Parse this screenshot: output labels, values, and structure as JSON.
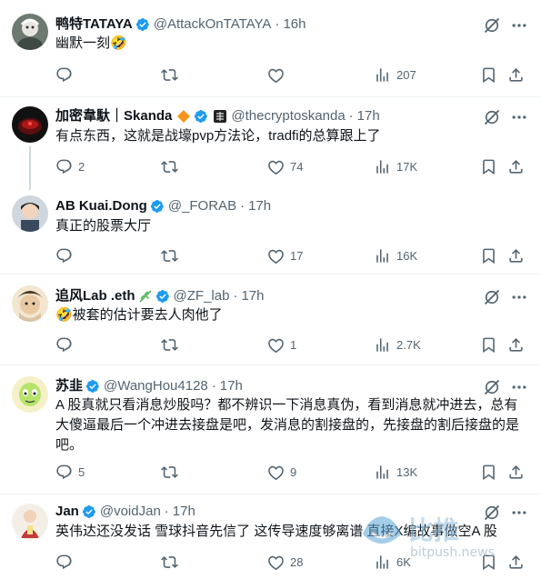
{
  "tweets": [
    {
      "name": "鸭特TATAYA",
      "handle": "@AttackOnTATAYA",
      "time": "16h",
      "text": "幽默一刻🤣",
      "replies": "",
      "retweets": "",
      "likes": "",
      "views": "207"
    },
    {
      "name": "加密韋馱｜Skanda",
      "handle": "@thecryptoskanda",
      "time": "17h",
      "text": "有点东西，这就是战壕pvp方法论，tradfi的总算跟上了",
      "replies": "2",
      "retweets": "",
      "likes": "74",
      "views": "17K"
    },
    {
      "name": "AB Kuai.Dong",
      "handle": "@_FORAB",
      "time": "17h",
      "text": "真正的股票大厅",
      "replies": "",
      "retweets": "",
      "likes": "17",
      "views": "16K"
    },
    {
      "name": "追风Lab .eth",
      "handle": "@ZF_lab",
      "time": "17h",
      "text": "🤣被套的估计要去人肉他了",
      "replies": "",
      "retweets": "",
      "likes": "1",
      "views": "2.7K"
    },
    {
      "name": "苏韭",
      "handle": "@WangHou4128",
      "time": "17h",
      "text": "A 股真就只看消息炒股吗？都不辨识一下消息真伪，看到消息就冲进去，总有大傻逼最后一个冲进去接盘是吧，发消息的割接盘的，先接盘的割后接盘的是吧。",
      "replies": "5",
      "retweets": "",
      "likes": "9",
      "views": "13K"
    },
    {
      "name": "Jan",
      "handle": "@voidJan",
      "time": "17h",
      "text": "英伟达还没发话 雪球抖音先信了 这传导速度够离谱 直接X编故事做空A 股",
      "replies": "",
      "retweets": "",
      "likes": "28",
      "views": "6K"
    }
  ],
  "ui": {
    "dot": "·"
  },
  "watermark": {
    "text_cn": "比推",
    "text_en": "bitpush.news"
  },
  "colors": {
    "verified": "#1d9bf0",
    "secondary_text": "#536471",
    "primary_text": "#0f1419",
    "divider": "#eff3f4",
    "thread_line": "#cfd9de",
    "diamond": "#f7931a"
  }
}
